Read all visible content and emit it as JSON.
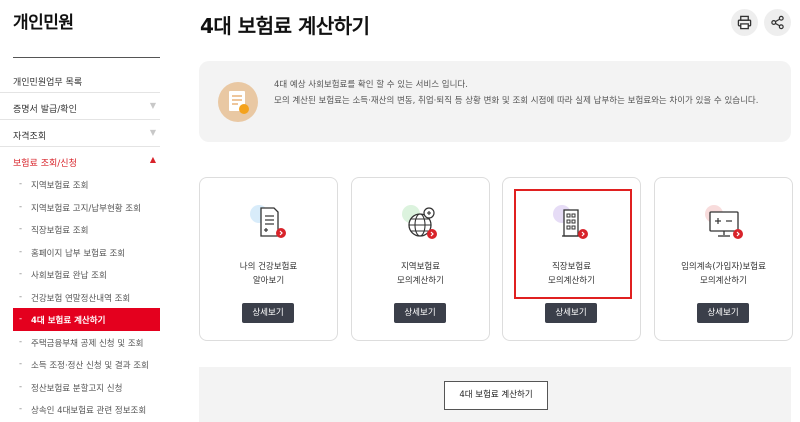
{
  "sidebar": {
    "title": "개인민원",
    "menu": [
      {
        "label": "개인민원업무 목록",
        "arrow": ""
      },
      {
        "label": "증명서 발급/확인",
        "arrow": "▼"
      },
      {
        "label": "자격조회",
        "arrow": "▼"
      },
      {
        "label": "보험료 조회/신청",
        "arrow": "▲"
      }
    ],
    "submenu": [
      "지역보험료 조회",
      "지역보험료 고지/납부현황 조회",
      "직장보험료 조회",
      "홈페이지 납부 보험료 조회",
      "사회보험료 완납 조회",
      "건강보험 연말정산내역 조회",
      "4대 보험료 계산하기",
      "주택금융부채 공제 신청 및 조회",
      "소득 조정·정산 신청 및 결과 조회",
      "정산보험료 분할고지 신청",
      "상속인 4대보험료 관련 정보조회"
    ],
    "dash": "-"
  },
  "header": {
    "title": "4대 보험료 계산하기"
  },
  "info": {
    "line1": "4대 예상 사회보험료를 확인 할 수 있는 서비스 입니다.",
    "line2": "모의 계산된 보험료는 소득·재산의 변동, 취업·퇴직 등 상황 변화 및 조회 시점에 따라 실제 납부하는 보험료와는 차이가 있을 수 있습니다."
  },
  "cards": [
    {
      "line1": "나의 건강보험료",
      "line2": "알아보기",
      "button": "상세보기",
      "icon": "document-icon",
      "accent": "#d8ecfa"
    },
    {
      "line1": "지역보험료",
      "line2": "모의계산하기",
      "button": "상세보기",
      "icon": "globe-icon",
      "accent": "#dcf3de"
    },
    {
      "line1": "직장보험료",
      "line2": "모의계산하기",
      "button": "상세보기",
      "icon": "building-icon",
      "accent": "#e6dcf6"
    },
    {
      "line1": "임의계속(가입자)보험료",
      "line2": "모의계산하기",
      "button": "상세보기",
      "icon": "calculator-monitor-icon",
      "accent": "#f8dcdc"
    }
  ],
  "bottom": {
    "button": "4대 보험료 계산하기"
  },
  "colors": {
    "brand_red": "#e4001e",
    "button_dark": "#3b3f4a"
  }
}
